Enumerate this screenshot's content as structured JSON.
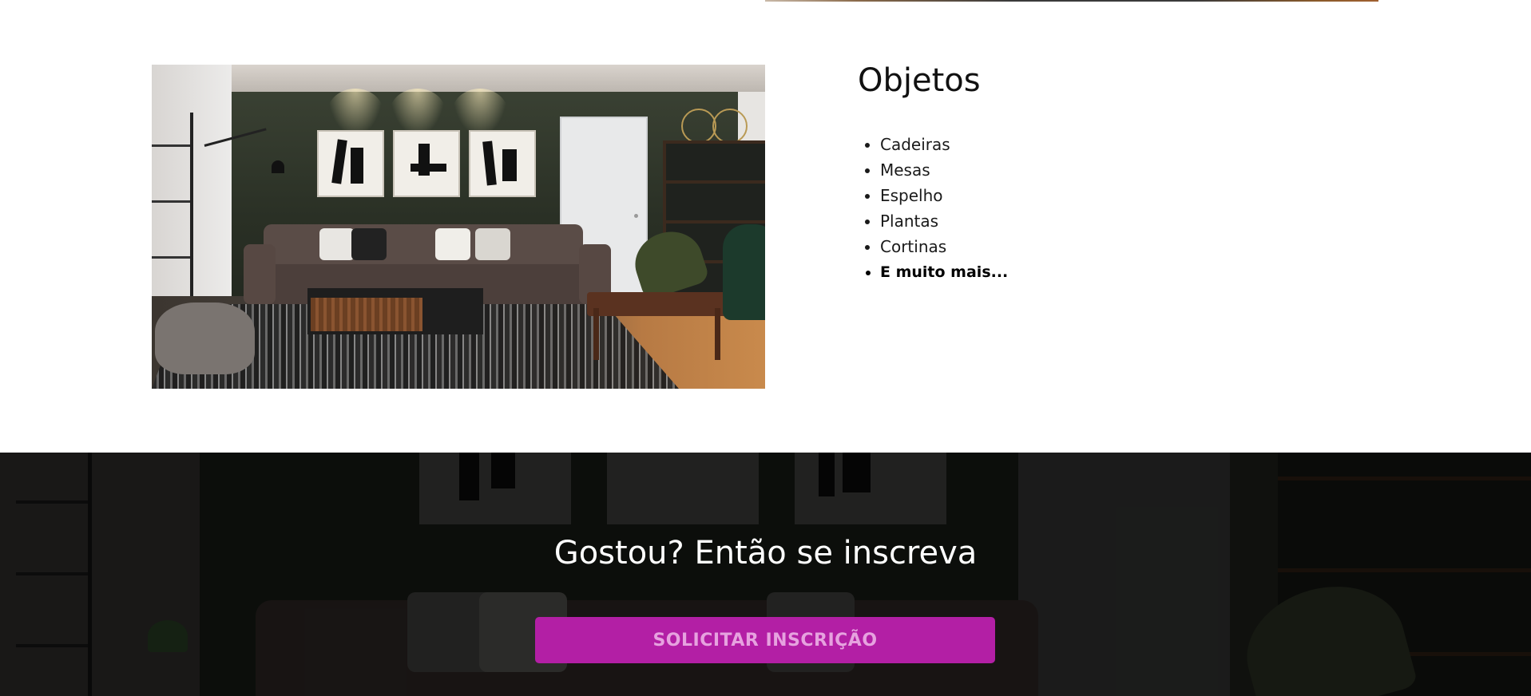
{
  "objetos": {
    "title": "Objetos",
    "items": [
      "Cadeiras",
      "Mesas",
      "Espelho",
      "Plantas",
      "Cortinas"
    ],
    "more_label": "E muito mais..."
  },
  "subscribe": {
    "title": "Gostou? Então se inscreva",
    "button_label": "SOLICITAR INSCRIÇÃO"
  },
  "colors": {
    "accent": "#b31fa5",
    "button_text": "#e6a2df",
    "banner_text": "#ffffff"
  }
}
